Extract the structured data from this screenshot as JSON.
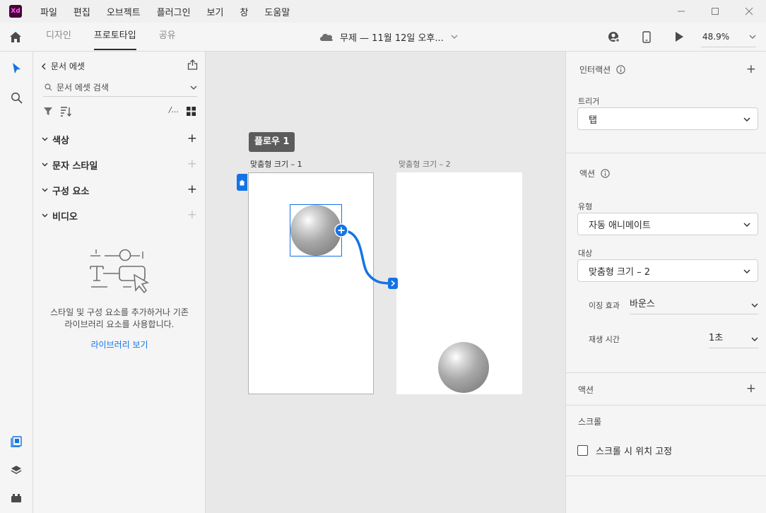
{
  "app": {
    "logo_text": "Xd"
  },
  "menu": [
    "파일",
    "편집",
    "오브젝트",
    "플러그인",
    "보기",
    "창",
    "도움말"
  ],
  "modes": {
    "design": "디자인",
    "prototype": "프로토타입",
    "share": "공유"
  },
  "document": {
    "title": "무제 — 11월 12일 오후..."
  },
  "zoom": {
    "value": "48.9%"
  },
  "assets": {
    "back_label": "문서 에셋",
    "search_placeholder": "문서 에셋 검색",
    "toolbar_text_icon": "/...",
    "sections": [
      "색상",
      "문자 스타일",
      "구성 요소",
      "비디오"
    ],
    "empty_text_1": "스타일 및 구성 요소를 추가하거나 기존",
    "empty_text_2": "라이브러리 요소를 사용합니다.",
    "library_link": "라이브러리 보기"
  },
  "canvas": {
    "flow_label": "플로우 1",
    "artboards": [
      "맞춤형 크기 – 1",
      "맞춤형 크기 – 2"
    ]
  },
  "inspector": {
    "interaction_title": "인터랙션",
    "trigger_label": "트리거",
    "trigger_value": "탭",
    "action_title": "액션",
    "type_label": "유형",
    "type_value": "자동 애니메이트",
    "destination_label": "대상",
    "destination_value": "맞춤형 크기 – 2",
    "easing_label": "이징 효과",
    "easing_value": "바운스",
    "duration_label": "재생 시간",
    "duration_value": "1초",
    "action2_title": "액션",
    "scroll_title": "스크롤",
    "scroll_fix_label": "스크롤 시 위치 고정"
  },
  "colors": {
    "accent": "#1473e6",
    "logo_bg": "#470137",
    "logo_fg": "#ff61f6"
  }
}
